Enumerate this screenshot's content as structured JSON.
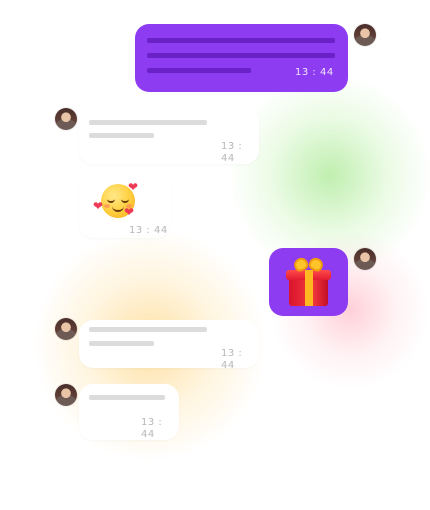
{
  "messages": [
    {
      "sender": "self",
      "type": "text",
      "time": "13 : 44"
    },
    {
      "sender": "other",
      "type": "text",
      "time": "13 : 44"
    },
    {
      "sender": "other",
      "type": "emoji",
      "emoji": "smiling-face-with-hearts",
      "time": "13 : 44"
    },
    {
      "sender": "self",
      "type": "sticker",
      "sticker": "wrapped-gift"
    },
    {
      "sender": "other",
      "type": "text",
      "time": "13 : 44"
    },
    {
      "sender": "other",
      "type": "text",
      "time": "13 : 44"
    }
  ],
  "colors": {
    "sent_bubble": "#8d3cf2",
    "received_bubble": "#ffffff",
    "placeholder_sent": "#6a21c7",
    "placeholder_received": "#dcdcdc"
  },
  "icons": {
    "avatar": "user-avatar",
    "heart": "❤"
  }
}
